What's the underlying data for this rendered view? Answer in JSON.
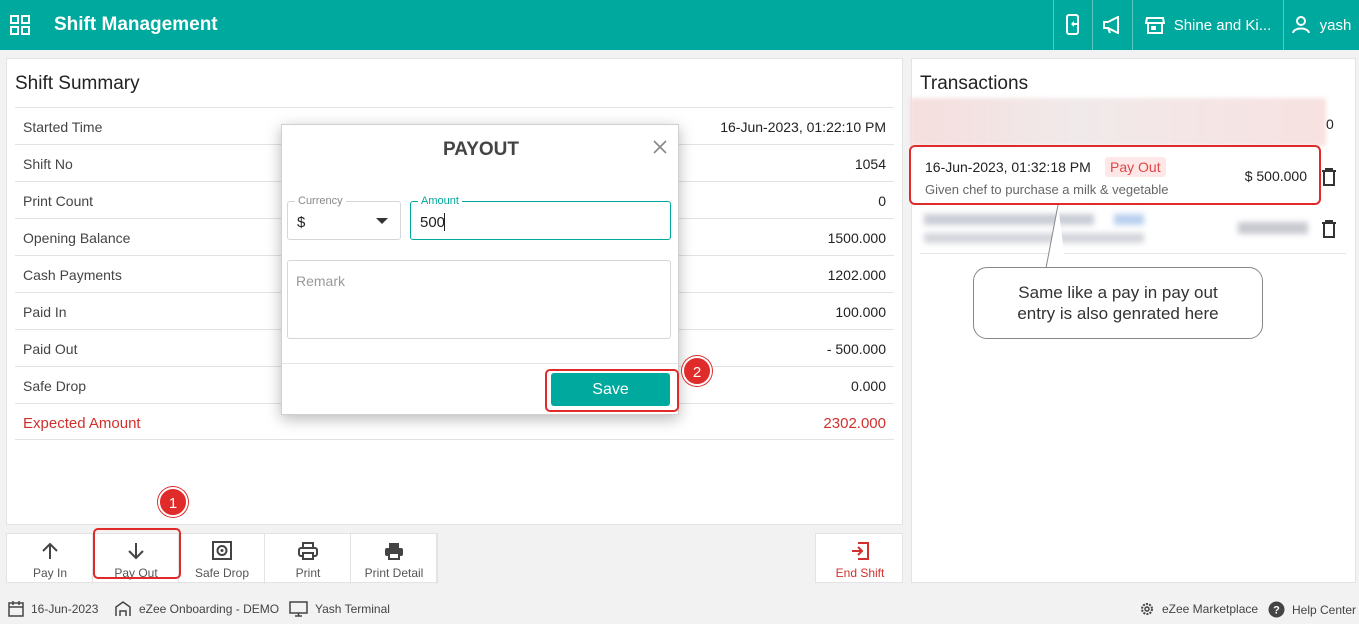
{
  "header": {
    "title": "Shift Management",
    "property": "Shine and Ki...",
    "user": "yash"
  },
  "summary": {
    "title": "Shift Summary",
    "rows": [
      {
        "label": "Started Time",
        "value": "16-Jun-2023, 01:22:10 PM"
      },
      {
        "label": "Shift No",
        "value": "1054"
      },
      {
        "label": "Print Count",
        "value": "0"
      },
      {
        "label": "Opening Balance",
        "value": "1500.000"
      },
      {
        "label": "Cash Payments",
        "value": "1202.000"
      },
      {
        "label": "Paid In",
        "value": "100.000"
      },
      {
        "label": "Paid Out",
        "value": "- 500.000"
      },
      {
        "label": "Safe Drop",
        "value": "0.000"
      },
      {
        "label": "Expected Amount",
        "value": "2302.000"
      }
    ]
  },
  "transactions": {
    "title": "Transactions",
    "first_blur_suffix": "0",
    "item": {
      "datetime": "16-Jun-2023, 01:32:18 PM",
      "type": "Pay Out",
      "remark": "Given chef to purchase a milk & vegetable",
      "amount": "$ 500.000"
    }
  },
  "callout": {
    "line1": "Same like a pay in pay out",
    "line2": "entry is also genrated here"
  },
  "modal": {
    "title": "PAYOUT",
    "currency_label": "Currency",
    "currency_value": "$",
    "amount_label": "Amount",
    "amount_value": "500",
    "remark_placeholder": "Remark",
    "save_label": "Save"
  },
  "actions": [
    {
      "label": "Pay In",
      "icon": "arrow-up-icon"
    },
    {
      "label": "Pay Out",
      "icon": "arrow-down-icon"
    },
    {
      "label": "Safe Drop",
      "icon": "safe-icon"
    },
    {
      "label": "Print",
      "icon": "printer-icon"
    },
    {
      "label": "Print Detail",
      "icon": "printer-detail-icon"
    }
  ],
  "end_shift": {
    "label": "End Shift",
    "icon": "exit-icon"
  },
  "markers": {
    "one": "1",
    "two": "2"
  },
  "footer": {
    "date": "16-Jun-2023",
    "hotel": "eZee Onboarding - DEMO",
    "terminal": "Yash Terminal",
    "marketplace": "eZee Marketplace",
    "help": "Help Center"
  },
  "colors": {
    "brand": "#00a99d",
    "danger": "#d0312d",
    "highlight": "#e02b2b"
  }
}
